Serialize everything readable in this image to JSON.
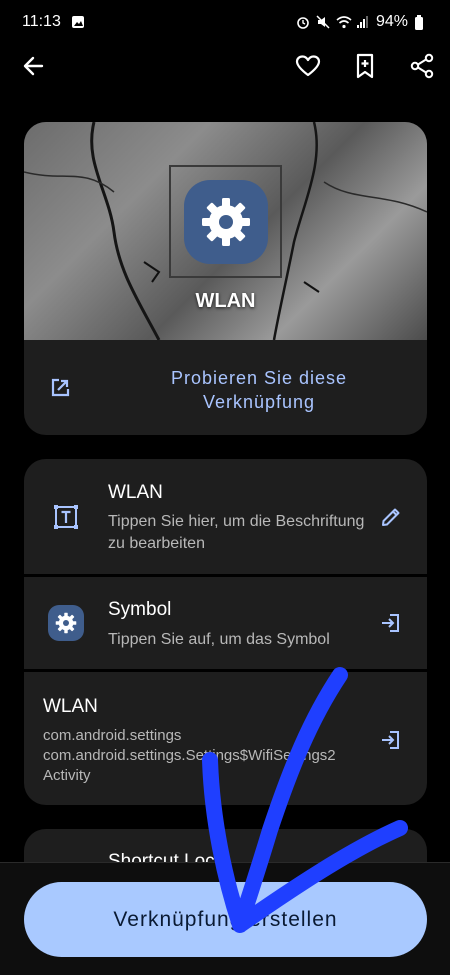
{
  "status_bar": {
    "time": "11:13",
    "battery": "94%"
  },
  "app_bar": {
    "back_icon": "arrow-left-icon",
    "favorite_icon": "heart-outline-icon",
    "bookmark_icon": "bookmark-add-icon",
    "share_icon": "share-icon"
  },
  "preview": {
    "title": "WLAN",
    "try_label": "Probieren Sie diese Verknüpfung",
    "icon": "settings-gear-icon"
  },
  "rows": [
    {
      "title": "WLAN",
      "subtitle": "Tippen Sie hier, um die Beschriftung zu bearbeiten",
      "leading_icon": "text-box-icon",
      "trailing_icon": "pencil-icon"
    },
    {
      "title": "Symbol",
      "subtitle": "Tippen Sie auf, um das Symbol",
      "leading_icon": "settings-gear-icon",
      "trailing_icon": "login-arrow-icon"
    },
    {
      "title": "WLAN",
      "line1": "com.android.settings",
      "line2": "com.android.settings.Settings$WifiSettings2",
      "line3": "Activity",
      "trailing_icon": "login-arrow-icon"
    }
  ],
  "next_card": {
    "title": "Shortcut Lock"
  },
  "cta": {
    "label": "Verknüpfung erstellen"
  },
  "colors": {
    "accent": "#a9c4ff",
    "button": "#a9c9ff",
    "card": "#1e1e1e",
    "icon_bg": "#3f5d8c",
    "scribble": "#1f3fff"
  }
}
